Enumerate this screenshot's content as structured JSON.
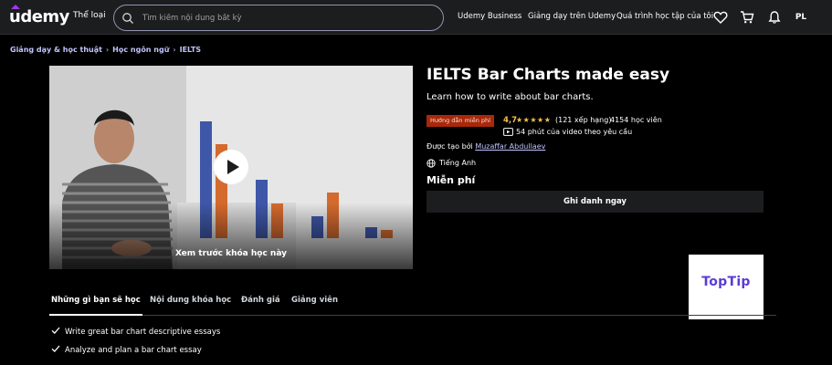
{
  "header": {
    "logo": "udemy",
    "categories": "Thể loại",
    "search_placeholder": "Tìm kiếm nội dung bất kỳ",
    "links": [
      "Udemy Business",
      "Giảng dạy trên Udemy",
      "Quá trình học tập của tôi"
    ],
    "avatar": "PL",
    "icons": [
      "heart-icon",
      "cart-icon",
      "bell-icon"
    ]
  },
  "breadcrumb": [
    "Giảng dạy & học thuật",
    "Học ngôn ngữ",
    "IELTS"
  ],
  "preview": {
    "label": "Xem trước khóa học này"
  },
  "course": {
    "title": "IELTS Bar Charts made easy",
    "subtitle": "Learn how to write about bar charts.",
    "badge": "Hướng dẫn miễn phí",
    "rating": "4,7",
    "stars": "★★★★★",
    "rating_count": "(121 xếp hạng)",
    "students": "4154 học viên",
    "duration": "54 phút của video theo yêu cầu",
    "author_prefix": "Được tạo bởi ",
    "author": "Muzaffar Abdullaev",
    "language": "Tiếng Anh",
    "price": "Miễn phí",
    "enroll_label": "Ghi danh ngay"
  },
  "watermark": "TopTip",
  "tabs": [
    "Những gì bạn sẽ học",
    "Nội dung khóa học",
    "Đánh giá",
    "Giảng viên"
  ],
  "learnings": [
    "Write great bar chart descriptive essays",
    "Analyze and plan a bar chart essay"
  ],
  "colors": {
    "accent_purple": "#c0c4fc",
    "badge": "#a8280a",
    "star": "#f4c150",
    "header_bg": "#1c1d1f"
  }
}
